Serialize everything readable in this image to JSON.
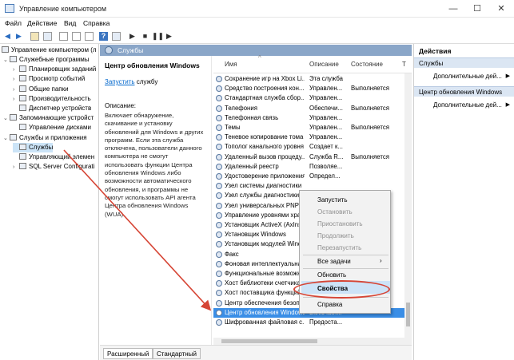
{
  "window": {
    "title": "Управление компьютером",
    "minimize": "—",
    "maximize": "☐",
    "close": "✕"
  },
  "menu": [
    "Файл",
    "Действие",
    "Вид",
    "Справка"
  ],
  "tree": {
    "root": "Управление компьютером (л",
    "items": [
      {
        "label": "Служебные программы",
        "level": 1,
        "arrow": "v"
      },
      {
        "label": "Планировщик заданий",
        "level": 2,
        "arrow": ">"
      },
      {
        "label": "Просмотр событий",
        "level": 2,
        "arrow": ">"
      },
      {
        "label": "Общие папки",
        "level": 2,
        "arrow": ">"
      },
      {
        "label": "Производительность",
        "level": 2,
        "arrow": ">"
      },
      {
        "label": "Диспетчер устройств",
        "level": 2,
        "arrow": ""
      },
      {
        "label": "Запоминающие устройст",
        "level": 1,
        "arrow": "v"
      },
      {
        "label": "Управление дисками",
        "level": 2,
        "arrow": ""
      },
      {
        "label": "Службы и приложения",
        "level": 1,
        "arrow": "v"
      },
      {
        "label": "Службы",
        "level": 2,
        "arrow": ""
      },
      {
        "label": "Управляющий элемен",
        "level": 2,
        "arrow": ""
      },
      {
        "label": "SQL Server Configurati",
        "level": 2,
        "arrow": ">"
      }
    ]
  },
  "services_header": "Службы",
  "description": {
    "title": "Центр обновления Windows",
    "start_link": "Запустить",
    "start_suffix": " службу",
    "label": "Описание:",
    "text": "Включает обнаружение, скачивание и установку обновлений для Windows и других программ. Если эта служба отключена, пользователи данного компьютера не смогут использовать функции Центра обновления Windows либо возможности автоматического обновления, и программы не смогут использовать API агента Центра обновления Windows (WUA)."
  },
  "columns": {
    "name": "Имя",
    "desc": "Описание",
    "state": "Состояние",
    "type": "Т"
  },
  "services": [
    {
      "name": "Сохранение игр на Xbox Li...",
      "desc": "Эта служба",
      "state": ""
    },
    {
      "name": "Средство построения кон...",
      "desc": "Управлен...",
      "state": "Выполняется"
    },
    {
      "name": "Стандартная служба сбор...",
      "desc": "Управлен...",
      "state": ""
    },
    {
      "name": "Телефония",
      "desc": "Обеспечи...",
      "state": "Выполняется"
    },
    {
      "name": "Телефонная связь",
      "desc": "Управлен...",
      "state": ""
    },
    {
      "name": "Темы",
      "desc": "Управлен...",
      "state": "Выполняется"
    },
    {
      "name": "Теневое копирование тома",
      "desc": "Управлен...",
      "state": ""
    },
    {
      "name": "Тополог канального уровня",
      "desc": "Создает к...",
      "state": ""
    },
    {
      "name": "Удаленный вызов процеду...",
      "desc": "Служба R...",
      "state": "Выполняется"
    },
    {
      "name": "Удаленный реестр",
      "desc": "Позволяе...",
      "state": ""
    },
    {
      "name": "Удостоверение приложения",
      "desc": "Определ...",
      "state": ""
    },
    {
      "name": "Узел системы диагностики",
      "desc": "",
      "state": ""
    },
    {
      "name": "Узел службы диагностики",
      "desc": "",
      "state": ""
    },
    {
      "name": "Узел универсальных PNP-...",
      "desc": "",
      "state": ""
    },
    {
      "name": "Управление уровнями хран...",
      "desc": "",
      "state": ""
    },
    {
      "name": "Установщик ActiveX (AxIns...",
      "desc": "",
      "state": ""
    },
    {
      "name": "Установщик Windows",
      "desc": "",
      "state": ""
    },
    {
      "name": "Установщик модулей Wind...",
      "desc": "",
      "state": ""
    },
    {
      "name": "Факс",
      "desc": "",
      "state": ""
    },
    {
      "name": "Фоновая интеллектуальная...",
      "desc": "",
      "state": ""
    },
    {
      "name": "Функциональные возможн...",
      "desc": "",
      "state": ""
    },
    {
      "name": "Хост библиотеки счетчика...",
      "desc": "",
      "state": ""
    },
    {
      "name": "Хост поставщика функций...",
      "desc": "",
      "state": ""
    },
    {
      "name": "Центр обеспечения безоп...",
      "desc": "",
      "state": ""
    },
    {
      "name": "Центр обновления Windows",
      "desc": "Включает...",
      "state": "",
      "selected": true
    },
    {
      "name": "Шифрованная файловая с...",
      "desc": "Предоста...",
      "state": ""
    }
  ],
  "context_menu": {
    "start": "Запустить",
    "stop": "Остановить",
    "pause": "Приостановить",
    "resume": "Продолжить",
    "restart": "Перезапустить",
    "all_tasks": "Все задачи",
    "refresh": "Обновить",
    "properties": "Свойства",
    "help": "Справка"
  },
  "tabs": {
    "extended": "Расширенный",
    "standard": "Стандартный"
  },
  "actions": {
    "title": "Действия",
    "section1": "Службы",
    "more1": "Дополнительные дей...",
    "section2": "Центр обновления Windows",
    "more2": "Дополнительные дей..."
  },
  "colors": {
    "accent": "#3a8ee6",
    "header": "#8aa6c8",
    "highlight_oval": "#d64535"
  }
}
